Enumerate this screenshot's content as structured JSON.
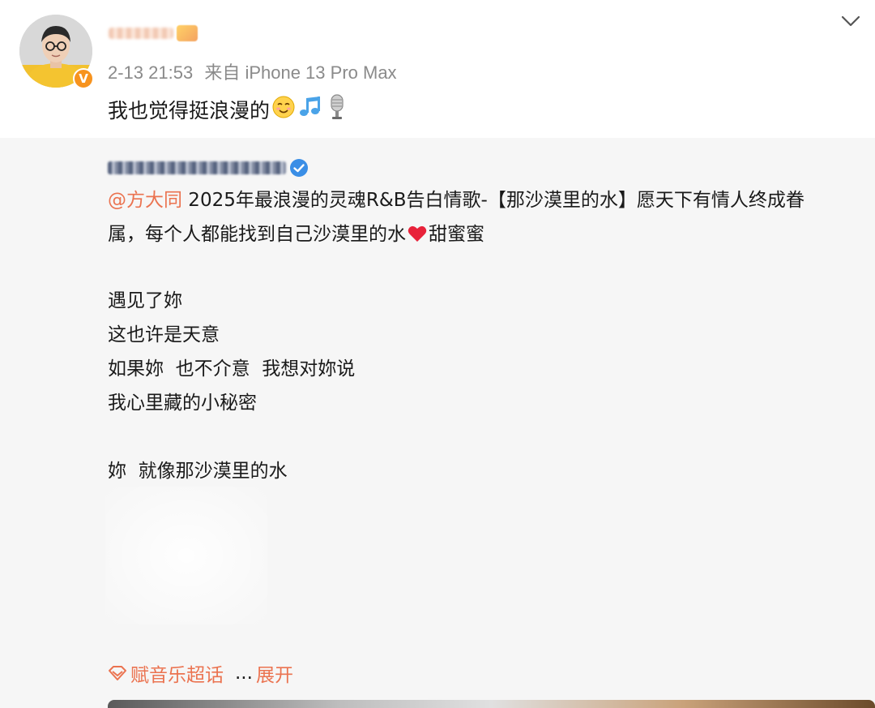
{
  "post": {
    "timestamp": "2-13 21:53",
    "source": "来自 iPhone 13 Pro Max",
    "text": "我也觉得挺浪漫的",
    "emojis": [
      "smile-emoji",
      "music-note-emoji",
      "microphone-emoji"
    ]
  },
  "repost": {
    "mention": "@方大同",
    "body_line1": " 2025年最浪漫的灵魂R&B告白情歌-【那沙漠里的水】愿天下有情人终成眷",
    "body_line2_a": "属，每个人都能找到自己沙漠里的水",
    "body_line2_b": "甜蜜蜜",
    "lyrics": [
      "遇见了妳",
      "这也许是天意",
      "如果妳  也不介意  我想对妳说",
      "我心里藏的小秘密",
      "",
      "妳  就像那沙漠里的水"
    ],
    "supertopic": "赋音乐超话",
    "ellipsis": "...",
    "expand": "展开"
  },
  "colors": {
    "accent": "#eb7350",
    "meta_gray": "#8a8a8a",
    "verified_orange": "#f7931e",
    "verified_blue": "#3a8ee6",
    "repost_bg": "#f6f6f6"
  }
}
